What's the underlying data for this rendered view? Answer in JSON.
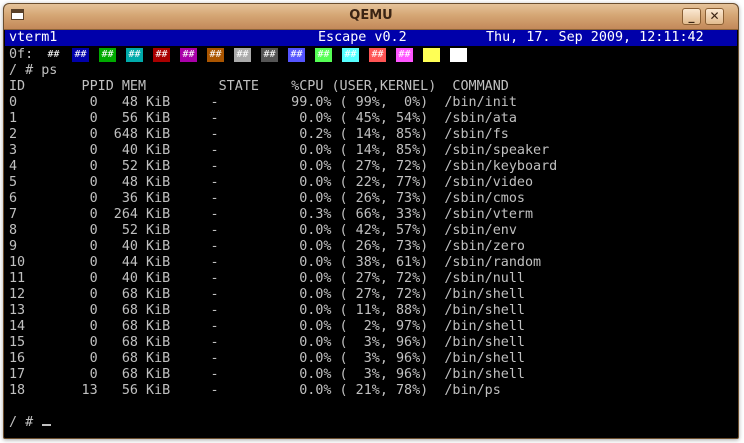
{
  "window": {
    "title": "QEMU",
    "minimize_label": "_",
    "close_label": "✕",
    "icon": "terminal-window-icon"
  },
  "statusbar": {
    "terminal_name": "vterm1",
    "version": "Escape v0.2",
    "datetime": "Thu, 17. Sep 2009, 12:11:42"
  },
  "palette": {
    "label": "0f:",
    "marker": "##",
    "colors": [
      "#000000",
      "#0000aa",
      "#00aa00",
      "#00aaaa",
      "#aa0000",
      "#aa00aa",
      "#aa5500",
      "#aaaaaa",
      "#555555",
      "#5555ff",
      "#55ff55",
      "#55ffff",
      "#ff5555",
      "#ff55ff",
      "#ffff55",
      "#ffffff"
    ]
  },
  "prompt": {
    "command_line": "/ # ps",
    "final_prompt": "/ # "
  },
  "table": {
    "header": "ID       PPID MEM         STATE    %CPU (USER,KERNEL)  COMMAND",
    "rows": [
      "0         0   48 KiB     -         99.0% ( 99%,  0%)  /bin/init",
      "1         0   56 KiB     -          0.0% ( 45%, 54%)  /sbin/ata",
      "2         0  648 KiB     -          0.2% ( 14%, 85%)  /sbin/fs",
      "3         0   40 KiB     -          0.0% ( 14%, 85%)  /sbin/speaker",
      "4         0   52 KiB     -          0.0% ( 27%, 72%)  /sbin/keyboard",
      "5         0   48 KiB     -          0.0% ( 22%, 77%)  /sbin/video",
      "6         0   36 KiB     -          0.0% ( 26%, 73%)  /sbin/cmos",
      "7         0  264 KiB     -          0.3% ( 66%, 33%)  /sbin/vterm",
      "8         0   52 KiB     -          0.0% ( 42%, 57%)  /sbin/env",
      "9         0   40 KiB     -          0.0% ( 26%, 73%)  /sbin/zero",
      "10        0   44 KiB     -          0.0% ( 38%, 61%)  /sbin/random",
      "11        0   40 KiB     -          0.0% ( 27%, 72%)  /sbin/null",
      "12        0   68 KiB     -          0.0% ( 27%, 72%)  /bin/shell",
      "13        0   68 KiB     -          0.0% ( 11%, 88%)  /bin/shell",
      "14        0   68 KiB     -          0.0% (  2%, 97%)  /bin/shell",
      "15        0   68 KiB     -          0.0% (  3%, 96%)  /bin/shell",
      "16        0   68 KiB     -          0.0% (  3%, 96%)  /bin/shell",
      "17        0   68 KiB     -          0.0% (  3%, 96%)  /bin/shell",
      "18       13   56 KiB     -          0.0% ( 21%, 78%)  /bin/ps"
    ]
  }
}
